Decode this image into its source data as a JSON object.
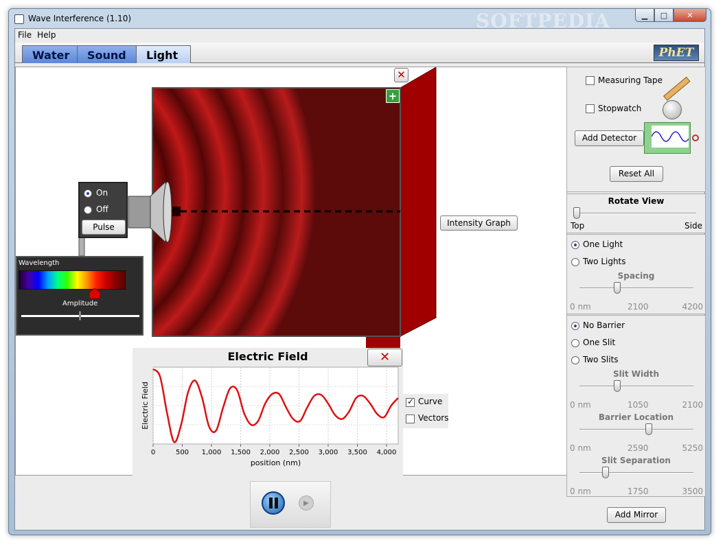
{
  "window": {
    "title": "Wave Interference (1.10)",
    "watermark": "SOFTPEDIA",
    "min_icon": "minimize-icon",
    "max_icon": "maximize-icon",
    "close_icon": "close-icon"
  },
  "menu": [
    "File",
    "Help"
  ],
  "tabs": [
    "Water",
    "Sound",
    "Light"
  ],
  "logo": "PhET",
  "source": {
    "on": "On",
    "off": "Off",
    "pulse": "Pulse",
    "wavelength": "Wavelength",
    "amplitude": "Amplitude",
    "amplitude_level": 0.5,
    "wavelength_level": 0.71
  },
  "intensity_graph_label": "Intensity Graph",
  "electric_field": {
    "title": "Electric Field",
    "curve": "Curve",
    "vectors": "Vectors",
    "curve_checked": true,
    "vectors_checked": false
  },
  "chart_data": {
    "type": "line",
    "title": "Electric Field",
    "xlabel": "position (nm)",
    "ylabel": "Electric Field",
    "xlim": [
      0,
      4200
    ],
    "x_ticks": [
      "0",
      "500",
      "1,000",
      "1,500",
      "2,000",
      "2,500",
      "3,000",
      "3,500",
      "4,000"
    ],
    "x_tick_values": [
      0,
      500,
      1000,
      1500,
      2000,
      2500,
      3000,
      3500,
      4000
    ],
    "grid": true,
    "series": [
      {
        "color": "#dd1111",
        "x": [
          0,
          120,
          240,
          360,
          480,
          600,
          720,
          840,
          960,
          1080,
          1200,
          1320,
          1440,
          1560,
          1680,
          1800,
          1920,
          2040,
          2160,
          2280,
          2400,
          2520,
          2640,
          2760,
          2880,
          3000,
          3120,
          3240,
          3360,
          3480,
          3600,
          3720,
          3840,
          3960,
          4080,
          4200
        ],
        "y": [
          0.95,
          0.75,
          -0.2,
          -0.95,
          -0.5,
          0.35,
          0.65,
          0.2,
          -0.55,
          -0.65,
          -0.05,
          0.45,
          0.4,
          -0.2,
          -0.5,
          -0.4,
          0.05,
          0.3,
          0.3,
          -0.05,
          -0.35,
          -0.4,
          -0.05,
          0.25,
          0.28,
          0.05,
          -0.25,
          -0.35,
          -0.15,
          0.2,
          0.25,
          0.05,
          -0.22,
          -0.3,
          0.0,
          0.2
        ]
      }
    ]
  },
  "tools": {
    "measuring_tape": "Measuring Tape",
    "stopwatch": "Stopwatch",
    "add_detector": "Add Detector",
    "reset_all": "Reset All"
  },
  "rotate_view": {
    "title": "Rotate View",
    "left": "Top",
    "right": "Side",
    "value": 0.0
  },
  "lights": {
    "one": "One Light",
    "two": "Two Lights",
    "selected": "one",
    "spacing": {
      "label": "Spacing",
      "min": "0 nm",
      "mid": "2100",
      "max": "4200",
      "value": 0.33
    }
  },
  "barrier": {
    "no": "No Barrier",
    "one": "One Slit",
    "two": "Two Slits",
    "selected": "no",
    "slit_width": {
      "label": "Slit Width",
      "min": "0 nm",
      "mid": "1050",
      "max": "2100",
      "value": 0.33
    },
    "barrier_location": {
      "label": "Barrier Location",
      "min": "0 nm",
      "mid": "2590",
      "max": "5250",
      "value": 0.61
    },
    "slit_separation": {
      "label": "Slit Separation",
      "min": "0 nm",
      "mid": "1750",
      "max": "3500",
      "value": 0.23
    }
  },
  "add_mirror": "Add Mirror",
  "playback": {
    "pause_icon": "pause-icon",
    "step_icon": "step-icon"
  }
}
